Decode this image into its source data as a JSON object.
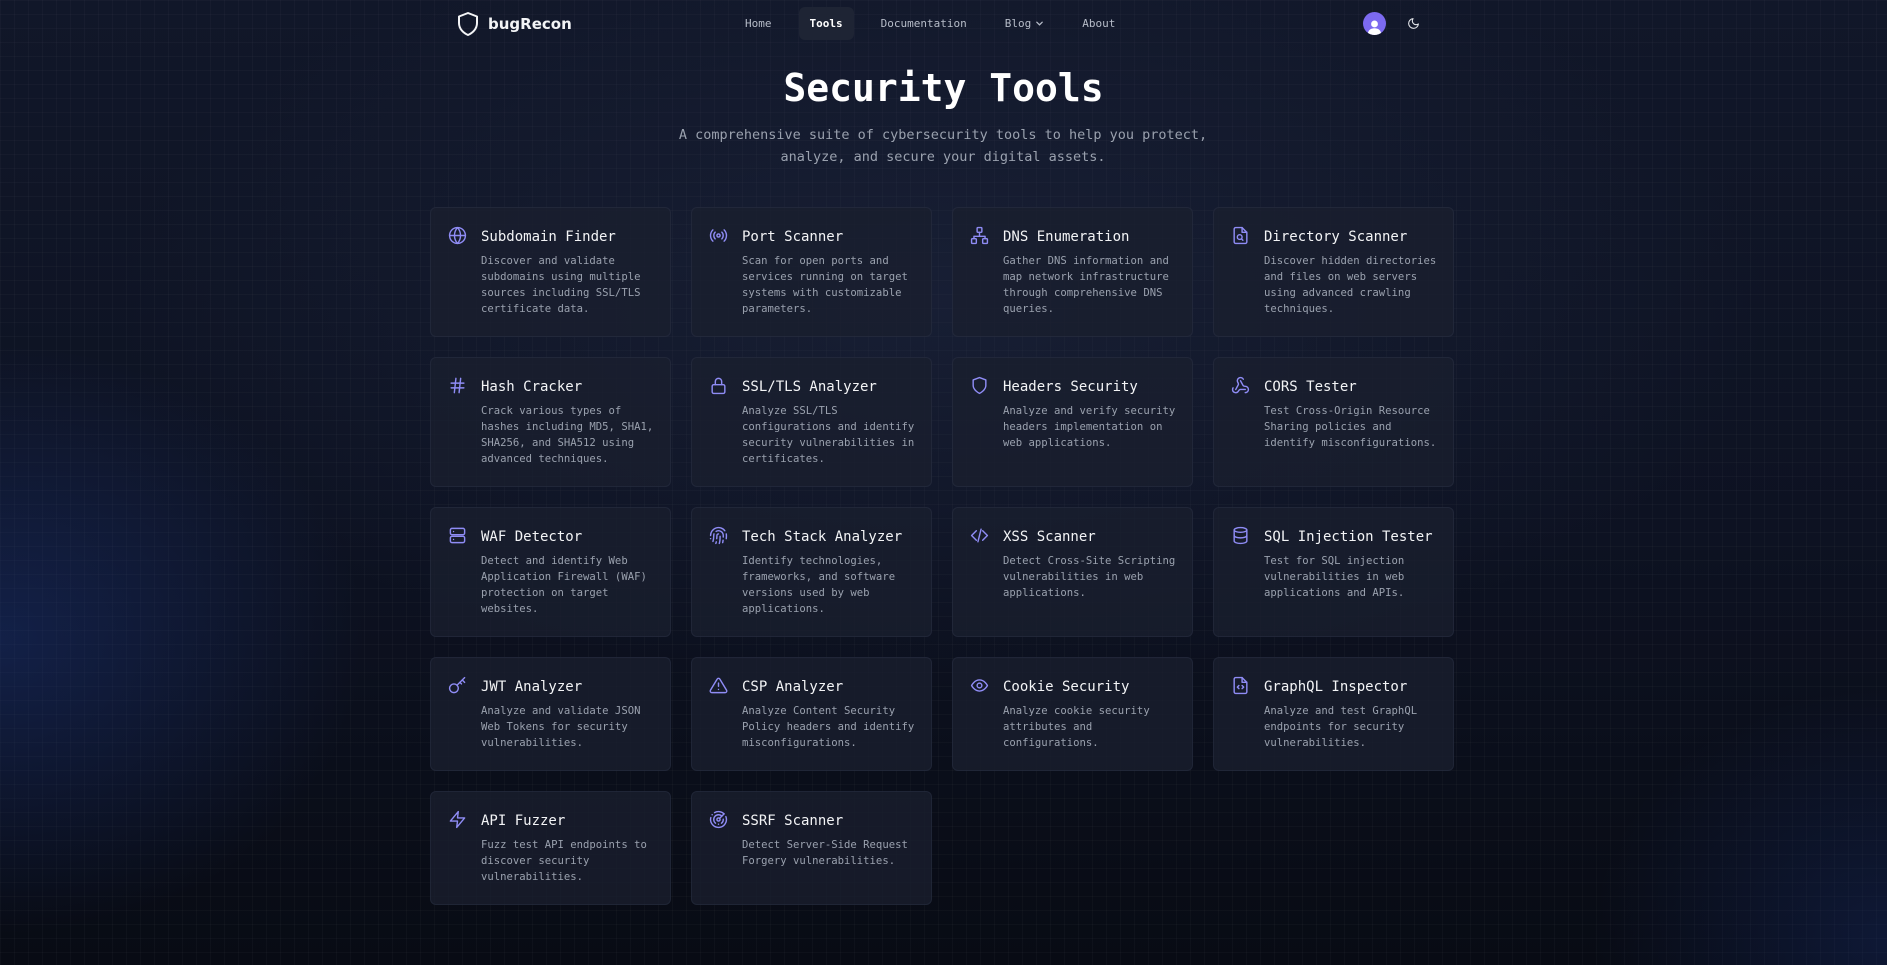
{
  "nav": {
    "brand": "bugRecon",
    "items": [
      {
        "label": "Home",
        "active": false
      },
      {
        "label": "Tools",
        "active": true
      },
      {
        "label": "Documentation",
        "active": false
      },
      {
        "label": "Blog",
        "active": false
      },
      {
        "label": "About",
        "active": false
      }
    ]
  },
  "hero": {
    "title": "Security Tools",
    "subtitle": "A comprehensive suite of cybersecurity tools to help you protect, analyze, and secure your digital assets."
  },
  "accent_color": "#8f8cf5",
  "tools": [
    {
      "title": "Subdomain Finder",
      "desc": "Discover and validate subdomains using multiple sources including SSL/TLS certificate data.",
      "icon": "globe-icon"
    },
    {
      "title": "Port Scanner",
      "desc": "Scan for open ports and services running on target systems with customizable parameters.",
      "icon": "radio-icon"
    },
    {
      "title": "DNS Enumeration",
      "desc": "Gather DNS information and map network infrastructure through comprehensive DNS queries.",
      "icon": "network-icon"
    },
    {
      "title": "Directory Scanner",
      "desc": "Discover hidden directories and files on web servers using advanced crawling techniques.",
      "icon": "file-search-icon"
    },
    {
      "title": "Hash Cracker",
      "desc": "Crack various types of hashes including MD5, SHA1, SHA256, and SHA512 using advanced techniques.",
      "icon": "hash-icon"
    },
    {
      "title": "SSL/TLS Analyzer",
      "desc": "Analyze SSL/TLS configurations and identify security vulnerabilities in certificates.",
      "icon": "lock-icon"
    },
    {
      "title": "Headers Security",
      "desc": "Analyze and verify security headers implementation on web applications.",
      "icon": "shield-icon"
    },
    {
      "title": "CORS Tester",
      "desc": "Test Cross-Origin Resource Sharing policies and identify misconfigurations.",
      "icon": "webhook-icon"
    },
    {
      "title": "WAF Detector",
      "desc": "Detect and identify Web Application Firewall (WAF) protection on target websites.",
      "icon": "server-icon"
    },
    {
      "title": "Tech Stack Analyzer",
      "desc": "Identify technologies, frameworks, and software versions used by web applications.",
      "icon": "fingerprint-icon"
    },
    {
      "title": "XSS Scanner",
      "desc": "Detect Cross-Site Scripting vulnerabilities in web applications.",
      "icon": "code-icon"
    },
    {
      "title": "SQL Injection Tester",
      "desc": "Test for SQL injection vulnerabilities in web applications and APIs.",
      "icon": "database-icon"
    },
    {
      "title": "JWT Analyzer",
      "desc": "Analyze and validate JSON Web Tokens for security vulnerabilities.",
      "icon": "key-icon"
    },
    {
      "title": "CSP Analyzer",
      "desc": "Analyze Content Security Policy headers and identify misconfigurations.",
      "icon": "alert-triangle-icon"
    },
    {
      "title": "Cookie Security",
      "desc": "Analyze cookie security attributes and configurations.",
      "icon": "eye-icon"
    },
    {
      "title": "GraphQL Inspector",
      "desc": "Analyze and test GraphQL endpoints for security vulnerabilities.",
      "icon": "file-code-icon"
    },
    {
      "title": "API Fuzzer",
      "desc": "Fuzz test API endpoints to discover security vulnerabilities.",
      "icon": "zap-icon"
    },
    {
      "title": "SSRF Scanner",
      "desc": "Detect Server-Side Request Forgery vulnerabilities.",
      "icon": "radar-icon"
    }
  ]
}
